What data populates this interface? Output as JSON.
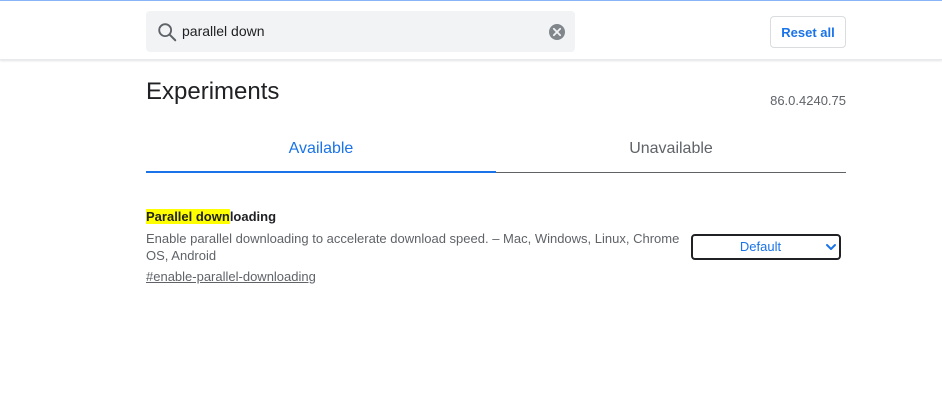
{
  "search": {
    "value": "parallel down"
  },
  "header": {
    "reset_label": "Reset all"
  },
  "main": {
    "title": "Experiments",
    "version": "86.0.4240.75",
    "tabs": [
      {
        "label": "Available",
        "active": true
      },
      {
        "label": "Unavailable",
        "active": false
      }
    ]
  },
  "experiments": [
    {
      "name_highlight": "Parallel down",
      "name_rest": "loading",
      "description": "Enable parallel downloading to accelerate download speed. – Mac, Windows, Linux, Chrome OS, Android",
      "link": "#enable-parallel-downloading",
      "selected_option": "Default"
    }
  ],
  "icons": {
    "search": "search-icon",
    "clear": "clear-icon",
    "dropdown": "chevron-down-icon"
  },
  "colors": {
    "accent": "#1a73e8",
    "highlight": "#ffff00",
    "search_bg": "#f1f3f4",
    "secondary_text": "#5f6368"
  }
}
